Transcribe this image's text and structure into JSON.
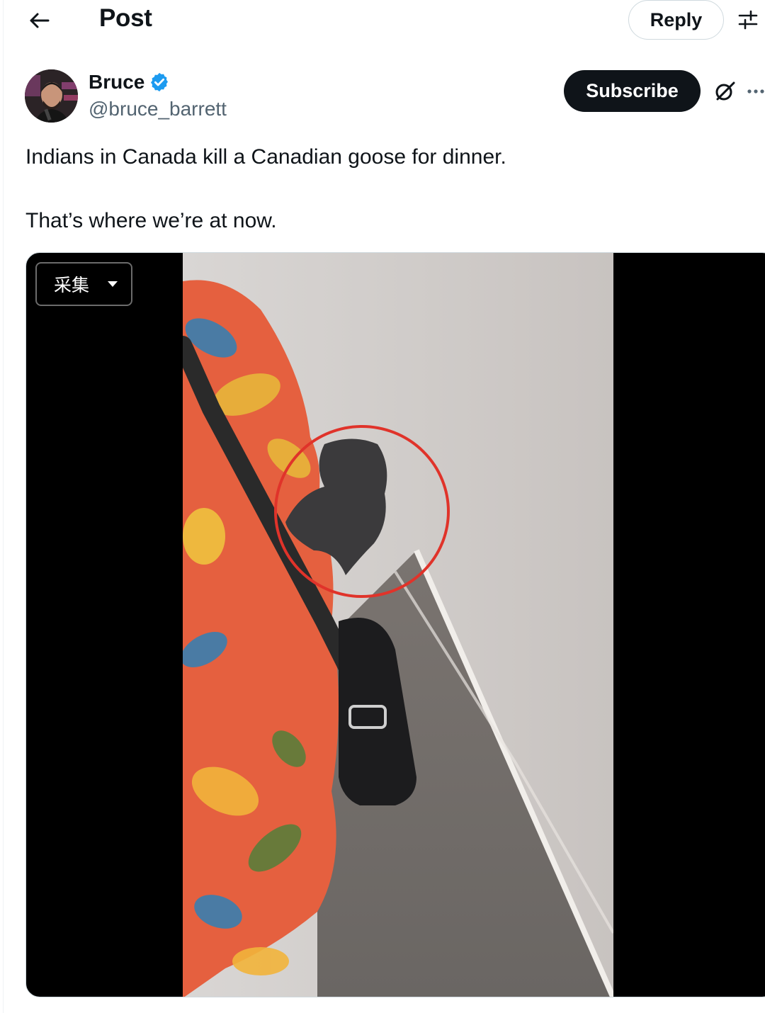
{
  "header": {
    "title": "Post",
    "reply_label": "Reply",
    "icons": {
      "back": "arrow-left-icon",
      "tune": "sliders-icon"
    }
  },
  "author": {
    "name": "Bruce",
    "handle": "@bruce_barrett",
    "verified": true,
    "verified_color": "#1d9bf0",
    "subscribe_label": "Subscribe",
    "icons": {
      "grok": "grok-icon",
      "more": "more-icon"
    }
  },
  "post": {
    "text_lines": [
      "Indians in Canada kill a Canadian goose for dinner.",
      "That’s where we’re at now."
    ]
  },
  "media": {
    "type": "video",
    "overlay_button_label": "采集",
    "highlight_color": "#e0332a"
  }
}
